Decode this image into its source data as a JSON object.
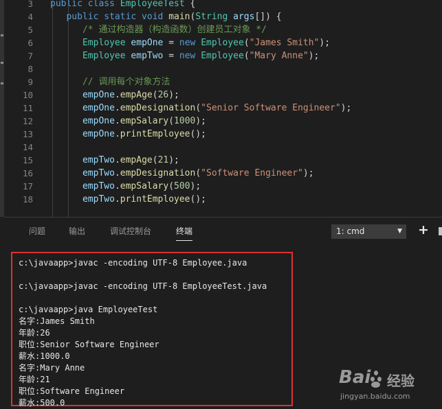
{
  "editor": {
    "lines": [
      {
        "num": "3",
        "tokens": [
          {
            "t": "public class ",
            "c": "kw"
          },
          {
            "t": "EmployeeTest",
            "c": "ty"
          },
          {
            "t": " {",
            "c": "pl"
          }
        ]
      },
      {
        "num": "4",
        "tokens": [
          {
            "t": "   ",
            "c": "pl"
          },
          {
            "t": "public static void ",
            "c": "kw"
          },
          {
            "t": "main",
            "c": "fn"
          },
          {
            "t": "(",
            "c": "pl"
          },
          {
            "t": "String",
            "c": "ty"
          },
          {
            "t": " ",
            "c": "pl"
          },
          {
            "t": "args",
            "c": "vr"
          },
          {
            "t": "[]) {",
            "c": "pl"
          }
        ]
      },
      {
        "num": "5",
        "tokens": [
          {
            "t": "      ",
            "c": "pl"
          },
          {
            "t": "/* 通过构造器（构造函数）创建员工对象 */",
            "c": "cm"
          }
        ]
      },
      {
        "num": "6",
        "tokens": [
          {
            "t": "      ",
            "c": "pl"
          },
          {
            "t": "Employee",
            "c": "ty"
          },
          {
            "t": " ",
            "c": "pl"
          },
          {
            "t": "empOne",
            "c": "vr"
          },
          {
            "t": " = ",
            "c": "pl"
          },
          {
            "t": "new ",
            "c": "kw"
          },
          {
            "t": "Employee",
            "c": "ty"
          },
          {
            "t": "(",
            "c": "pl"
          },
          {
            "t": "\"James Smith\"",
            "c": "st"
          },
          {
            "t": ");",
            "c": "pl"
          }
        ]
      },
      {
        "num": "7",
        "tokens": [
          {
            "t": "      ",
            "c": "pl"
          },
          {
            "t": "Employee",
            "c": "ty"
          },
          {
            "t": " ",
            "c": "pl"
          },
          {
            "t": "empTwo",
            "c": "vr"
          },
          {
            "t": " = ",
            "c": "pl"
          },
          {
            "t": "new ",
            "c": "kw"
          },
          {
            "t": "Employee",
            "c": "ty"
          },
          {
            "t": "(",
            "c": "pl"
          },
          {
            "t": "\"Mary Anne\"",
            "c": "st"
          },
          {
            "t": ");",
            "c": "pl"
          }
        ]
      },
      {
        "num": "8",
        "tokens": []
      },
      {
        "num": "9",
        "tokens": [
          {
            "t": "      ",
            "c": "pl"
          },
          {
            "t": "// 调用每个对象方法",
            "c": "cm"
          }
        ]
      },
      {
        "num": "10",
        "tokens": [
          {
            "t": "      ",
            "c": "pl"
          },
          {
            "t": "empOne",
            "c": "vr"
          },
          {
            "t": ".",
            "c": "pl"
          },
          {
            "t": "empAge",
            "c": "fn"
          },
          {
            "t": "(",
            "c": "pl"
          },
          {
            "t": "26",
            "c": "nm"
          },
          {
            "t": ");",
            "c": "pl"
          }
        ]
      },
      {
        "num": "11",
        "tokens": [
          {
            "t": "      ",
            "c": "pl"
          },
          {
            "t": "empOne",
            "c": "vr"
          },
          {
            "t": ".",
            "c": "pl"
          },
          {
            "t": "empDesignation",
            "c": "fn"
          },
          {
            "t": "(",
            "c": "pl"
          },
          {
            "t": "\"Senior Software Engineer\"",
            "c": "st"
          },
          {
            "t": ");",
            "c": "pl"
          }
        ]
      },
      {
        "num": "12",
        "tokens": [
          {
            "t": "      ",
            "c": "pl"
          },
          {
            "t": "empOne",
            "c": "vr"
          },
          {
            "t": ".",
            "c": "pl"
          },
          {
            "t": "empSalary",
            "c": "fn"
          },
          {
            "t": "(",
            "c": "pl"
          },
          {
            "t": "1000",
            "c": "nm"
          },
          {
            "t": ");",
            "c": "pl"
          }
        ]
      },
      {
        "num": "13",
        "tokens": [
          {
            "t": "      ",
            "c": "pl"
          },
          {
            "t": "empOne",
            "c": "vr"
          },
          {
            "t": ".",
            "c": "pl"
          },
          {
            "t": "printEmployee",
            "c": "fn"
          },
          {
            "t": "();",
            "c": "pl"
          }
        ]
      },
      {
        "num": "14",
        "tokens": []
      },
      {
        "num": "15",
        "tokens": [
          {
            "t": "      ",
            "c": "pl"
          },
          {
            "t": "empTwo",
            "c": "vr"
          },
          {
            "t": ".",
            "c": "pl"
          },
          {
            "t": "empAge",
            "c": "fn"
          },
          {
            "t": "(",
            "c": "pl"
          },
          {
            "t": "21",
            "c": "nm"
          },
          {
            "t": ");",
            "c": "pl"
          }
        ]
      },
      {
        "num": "16",
        "tokens": [
          {
            "t": "      ",
            "c": "pl"
          },
          {
            "t": "empTwo",
            "c": "vr"
          },
          {
            "t": ".",
            "c": "pl"
          },
          {
            "t": "empDesignation",
            "c": "fn"
          },
          {
            "t": "(",
            "c": "pl"
          },
          {
            "t": "\"Software Engineer\"",
            "c": "st"
          },
          {
            "t": ");",
            "c": "pl"
          }
        ]
      },
      {
        "num": "17",
        "tokens": [
          {
            "t": "      ",
            "c": "pl"
          },
          {
            "t": "empTwo",
            "c": "vr"
          },
          {
            "t": ".",
            "c": "pl"
          },
          {
            "t": "empSalary",
            "c": "fn"
          },
          {
            "t": "(",
            "c": "pl"
          },
          {
            "t": "500",
            "c": "nm"
          },
          {
            "t": ");",
            "c": "pl"
          }
        ]
      },
      {
        "num": "18",
        "tokens": [
          {
            "t": "      ",
            "c": "pl"
          },
          {
            "t": "empTwo",
            "c": "vr"
          },
          {
            "t": ".",
            "c": "pl"
          },
          {
            "t": "printEmployee",
            "c": "fn"
          },
          {
            "t": "();",
            "c": "pl"
          }
        ]
      }
    ]
  },
  "panel": {
    "tabs": {
      "problems": "问题",
      "output": "输出",
      "debug_console": "调试控制台",
      "terminal": "终端"
    },
    "terminal_select": "1: cmd",
    "terminal_lines": [
      "c:\\javaapp>javac -encoding UTF-8 Employee.java",
      "",
      "c:\\javaapp>javac -encoding UTF-8 EmployeeTest.java",
      "",
      "c:\\javaapp>java EmployeeTest",
      "名字:James Smith",
      "年龄:26",
      "职位:Senior Software Engineer",
      "薪水:1000.0",
      "名字:Mary Anne",
      "年龄:21",
      "职位:Software Engineer",
      "薪水:500.0"
    ]
  },
  "watermark": {
    "brand": "Bai",
    "brand_tail": "经验",
    "url": "jingyan.baidu.com"
  },
  "colors": {
    "highlight_border": "#e03232",
    "editor_bg": "#1e1e1e"
  }
}
